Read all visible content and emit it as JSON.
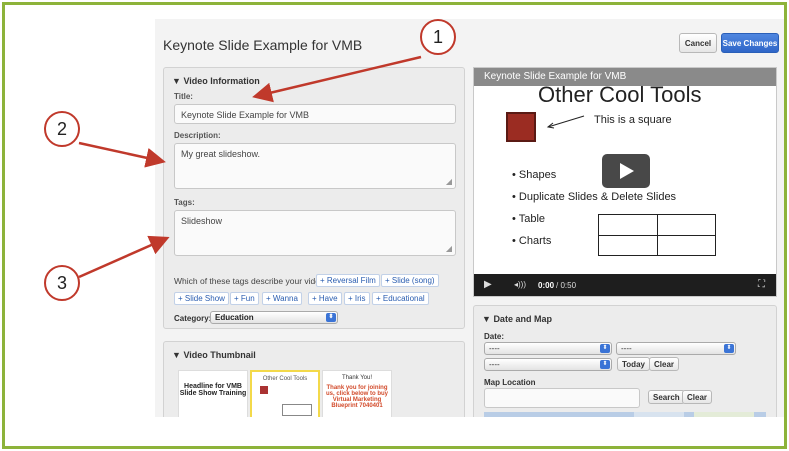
{
  "page": {
    "title": "Keynote Slide Example for VMB"
  },
  "header": {
    "cancel_label": "Cancel",
    "save_label": "Save Changes"
  },
  "video_info": {
    "heading": "Video Information",
    "title_label": "Title:",
    "title_value": "Keynote Slide Example for VMB",
    "description_label": "Description:",
    "description_value": "My great slideshow.",
    "tags_label": "Tags:",
    "tags_value": "Slideshow",
    "tags_question": "Which of these tags describe your video?",
    "suggested_tags": [
      "+ Reversal Film",
      "+ Slide (song)",
      "+ Slide Show",
      "+ Fun",
      "+ Wanna",
      "+ Have",
      "+ Iris",
      "+ Educational"
    ],
    "category_label": "Category:",
    "category_value": "Education"
  },
  "thumbnail": {
    "heading": "Video Thumbnail",
    "thumbs": [
      {
        "text": "Headline for VMB Slide Show Training"
      },
      {
        "text": "Other Cool Tools"
      },
      {
        "title": "Thank You!",
        "text": "Thank you for joining us, click below to buy Virtual Marketing Blueprint 7040401"
      }
    ]
  },
  "player": {
    "bar_title": "Keynote Slide Example for VMB",
    "slide_title": "Other Cool Tools",
    "square_caption": "This is a square",
    "bullets": [
      "Shapes",
      "Duplicate Slides & Delete Slides",
      "Table",
      "Charts"
    ],
    "time": "0:00",
    "duration": "/ 0:50"
  },
  "date_map": {
    "heading": "Date and Map",
    "date_label": "Date:",
    "select_placeholder": "----",
    "today_label": "Today",
    "clear_label": "Clear",
    "map_label": "Map Location",
    "search_label": "Search",
    "clear2_label": "Clear"
  },
  "callouts": [
    "1",
    "2",
    "3"
  ],
  "colors": {
    "accent_green": "#8db33a",
    "callout_red": "#c0392b",
    "save_blue": "#2f66c8"
  }
}
